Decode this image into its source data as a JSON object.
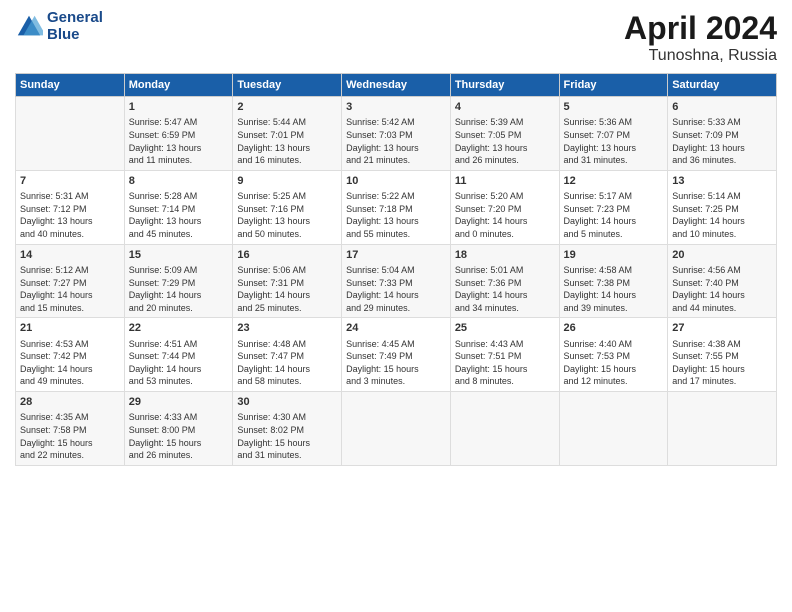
{
  "header": {
    "logo_line1": "General",
    "logo_line2": "Blue",
    "month_title": "April 2024",
    "location": "Tunoshna, Russia"
  },
  "columns": [
    "Sunday",
    "Monday",
    "Tuesday",
    "Wednesday",
    "Thursday",
    "Friday",
    "Saturday"
  ],
  "weeks": [
    [
      {
        "day": "",
        "info": ""
      },
      {
        "day": "1",
        "info": "Sunrise: 5:47 AM\nSunset: 6:59 PM\nDaylight: 13 hours\nand 11 minutes."
      },
      {
        "day": "2",
        "info": "Sunrise: 5:44 AM\nSunset: 7:01 PM\nDaylight: 13 hours\nand 16 minutes."
      },
      {
        "day": "3",
        "info": "Sunrise: 5:42 AM\nSunset: 7:03 PM\nDaylight: 13 hours\nand 21 minutes."
      },
      {
        "day": "4",
        "info": "Sunrise: 5:39 AM\nSunset: 7:05 PM\nDaylight: 13 hours\nand 26 minutes."
      },
      {
        "day": "5",
        "info": "Sunrise: 5:36 AM\nSunset: 7:07 PM\nDaylight: 13 hours\nand 31 minutes."
      },
      {
        "day": "6",
        "info": "Sunrise: 5:33 AM\nSunset: 7:09 PM\nDaylight: 13 hours\nand 36 minutes."
      }
    ],
    [
      {
        "day": "7",
        "info": "Sunrise: 5:31 AM\nSunset: 7:12 PM\nDaylight: 13 hours\nand 40 minutes."
      },
      {
        "day": "8",
        "info": "Sunrise: 5:28 AM\nSunset: 7:14 PM\nDaylight: 13 hours\nand 45 minutes."
      },
      {
        "day": "9",
        "info": "Sunrise: 5:25 AM\nSunset: 7:16 PM\nDaylight: 13 hours\nand 50 minutes."
      },
      {
        "day": "10",
        "info": "Sunrise: 5:22 AM\nSunset: 7:18 PM\nDaylight: 13 hours\nand 55 minutes."
      },
      {
        "day": "11",
        "info": "Sunrise: 5:20 AM\nSunset: 7:20 PM\nDaylight: 14 hours\nand 0 minutes."
      },
      {
        "day": "12",
        "info": "Sunrise: 5:17 AM\nSunset: 7:23 PM\nDaylight: 14 hours\nand 5 minutes."
      },
      {
        "day": "13",
        "info": "Sunrise: 5:14 AM\nSunset: 7:25 PM\nDaylight: 14 hours\nand 10 minutes."
      }
    ],
    [
      {
        "day": "14",
        "info": "Sunrise: 5:12 AM\nSunset: 7:27 PM\nDaylight: 14 hours\nand 15 minutes."
      },
      {
        "day": "15",
        "info": "Sunrise: 5:09 AM\nSunset: 7:29 PM\nDaylight: 14 hours\nand 20 minutes."
      },
      {
        "day": "16",
        "info": "Sunrise: 5:06 AM\nSunset: 7:31 PM\nDaylight: 14 hours\nand 25 minutes."
      },
      {
        "day": "17",
        "info": "Sunrise: 5:04 AM\nSunset: 7:33 PM\nDaylight: 14 hours\nand 29 minutes."
      },
      {
        "day": "18",
        "info": "Sunrise: 5:01 AM\nSunset: 7:36 PM\nDaylight: 14 hours\nand 34 minutes."
      },
      {
        "day": "19",
        "info": "Sunrise: 4:58 AM\nSunset: 7:38 PM\nDaylight: 14 hours\nand 39 minutes."
      },
      {
        "day": "20",
        "info": "Sunrise: 4:56 AM\nSunset: 7:40 PM\nDaylight: 14 hours\nand 44 minutes."
      }
    ],
    [
      {
        "day": "21",
        "info": "Sunrise: 4:53 AM\nSunset: 7:42 PM\nDaylight: 14 hours\nand 49 minutes."
      },
      {
        "day": "22",
        "info": "Sunrise: 4:51 AM\nSunset: 7:44 PM\nDaylight: 14 hours\nand 53 minutes."
      },
      {
        "day": "23",
        "info": "Sunrise: 4:48 AM\nSunset: 7:47 PM\nDaylight: 14 hours\nand 58 minutes."
      },
      {
        "day": "24",
        "info": "Sunrise: 4:45 AM\nSunset: 7:49 PM\nDaylight: 15 hours\nand 3 minutes."
      },
      {
        "day": "25",
        "info": "Sunrise: 4:43 AM\nSunset: 7:51 PM\nDaylight: 15 hours\nand 8 minutes."
      },
      {
        "day": "26",
        "info": "Sunrise: 4:40 AM\nSunset: 7:53 PM\nDaylight: 15 hours\nand 12 minutes."
      },
      {
        "day": "27",
        "info": "Sunrise: 4:38 AM\nSunset: 7:55 PM\nDaylight: 15 hours\nand 17 minutes."
      }
    ],
    [
      {
        "day": "28",
        "info": "Sunrise: 4:35 AM\nSunset: 7:58 PM\nDaylight: 15 hours\nand 22 minutes."
      },
      {
        "day": "29",
        "info": "Sunrise: 4:33 AM\nSunset: 8:00 PM\nDaylight: 15 hours\nand 26 minutes."
      },
      {
        "day": "30",
        "info": "Sunrise: 4:30 AM\nSunset: 8:02 PM\nDaylight: 15 hours\nand 31 minutes."
      },
      {
        "day": "",
        "info": ""
      },
      {
        "day": "",
        "info": ""
      },
      {
        "day": "",
        "info": ""
      },
      {
        "day": "",
        "info": ""
      }
    ]
  ]
}
